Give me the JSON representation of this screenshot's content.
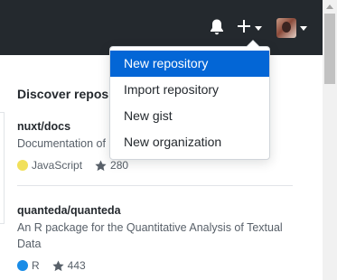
{
  "header": {
    "notifications_icon": "bell-icon",
    "create_icon": "plus-icon",
    "avatar_icon": "user-avatar"
  },
  "main": {
    "discover_title": "Discover repositories",
    "repos": [
      {
        "name": "nuxt/docs",
        "description": "Documentation of Nuxt.js",
        "language": "JavaScript",
        "language_color": "#f1e05a",
        "stars": "280"
      },
      {
        "name": "quanteda/quanteda",
        "description": "An R package for the Quantitative Analysis of Textual Data",
        "language": "R",
        "language_color": "#198ce7",
        "stars": "443"
      }
    ]
  },
  "dropdown": {
    "items": [
      {
        "label": "New repository"
      },
      {
        "label": "Import repository"
      },
      {
        "label": "New gist"
      },
      {
        "label": "New organization"
      }
    ],
    "active_index": 0
  },
  "colors": {
    "topbar": "#24292e",
    "accent": "#0366d6"
  }
}
